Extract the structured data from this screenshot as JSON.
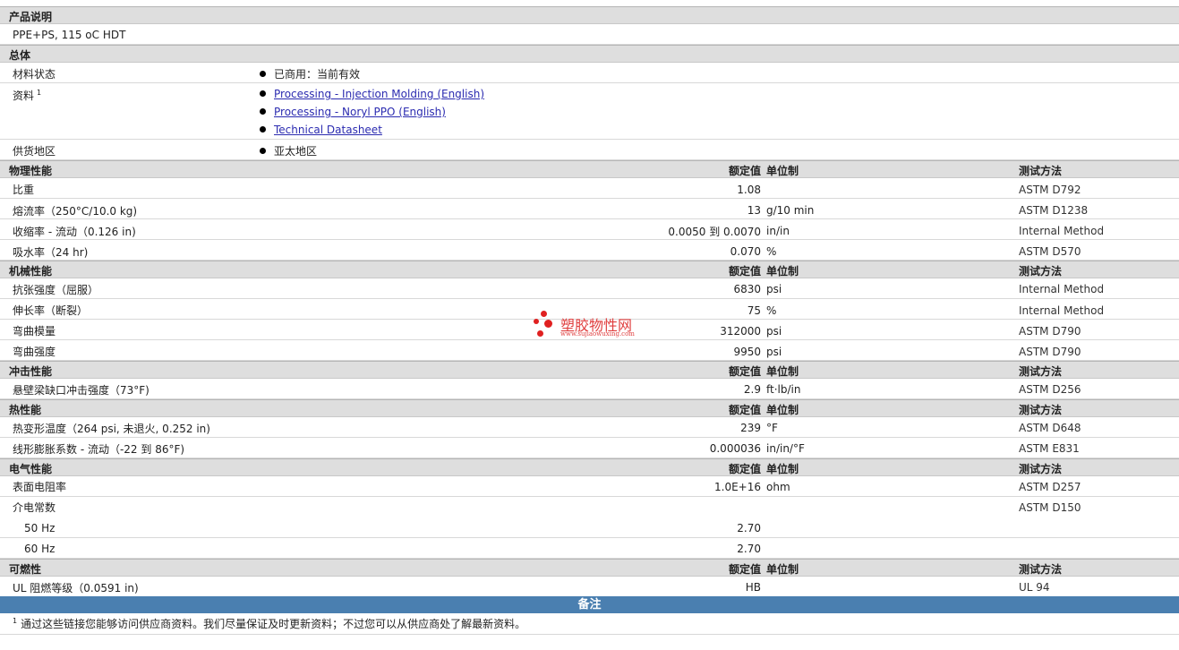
{
  "desc": {
    "title": "产品说明",
    "text": "PPE+PS, 115 oC HDT"
  },
  "general": {
    "title": "总体",
    "material_status_label": "材料状态",
    "material_status_value": "已商用：当前有效",
    "docs_label": "资料",
    "docs_sup": "1",
    "docs": [
      "Processing - Injection Molding (English)",
      "Processing - Noryl PPO (English)",
      "Technical Datasheet"
    ],
    "region_label": "供货地区",
    "region_value": "亚太地区"
  },
  "headers": {
    "value": "额定值",
    "unit": "单位制",
    "method": "测试方法"
  },
  "physical": {
    "title": "物理性能",
    "rows": [
      {
        "label": "比重",
        "value": "1.08",
        "unit": "",
        "method": "ASTM D792"
      },
      {
        "label": "熔流率（250°C/10.0 kg)",
        "value": "13",
        "unit": "g/10 min",
        "method": "ASTM D1238"
      },
      {
        "label": "收缩率 - 流动（0.126 in)",
        "value": "0.0050 到  0.0070",
        "unit": "in/in",
        "method": "Internal Method"
      },
      {
        "label": "吸水率（24 hr)",
        "value": "0.070",
        "unit": "%",
        "method": "ASTM D570"
      }
    ]
  },
  "mechanical": {
    "title": "机械性能",
    "rows": [
      {
        "label": "抗张强度（屈服）",
        "value": "6830",
        "unit": "psi",
        "method": "Internal Method"
      },
      {
        "label": "伸长率（断裂）",
        "value": "75",
        "unit": "%",
        "method": "Internal Method"
      },
      {
        "label": "弯曲模量",
        "value": "312000",
        "unit": "psi",
        "method": "ASTM D790"
      },
      {
        "label": "弯曲强度",
        "value": "9950",
        "unit": "psi",
        "method": "ASTM D790"
      }
    ]
  },
  "impact": {
    "title": "冲击性能",
    "rows": [
      {
        "label": "悬壁梁缺口冲击强度（73°F)",
        "value": "2.9",
        "unit": "ft·lb/in",
        "method": "ASTM D256"
      }
    ]
  },
  "thermal": {
    "title": "热性能",
    "rows": [
      {
        "label": "热变形温度（264 psi, 未退火, 0.252 in)",
        "value": "239",
        "unit": "°F",
        "method": "ASTM D648"
      },
      {
        "label": "线形膨胀系数 - 流动（-22 到  86°F)",
        "value": "0.000036",
        "unit": "in/in/°F",
        "method": "ASTM E831"
      }
    ]
  },
  "electrical": {
    "title": "电气性能",
    "rows": [
      {
        "label": "表面电阻率",
        "value": "1.0E+16",
        "unit": "ohm",
        "method": "ASTM D257"
      },
      {
        "label": "介电常数",
        "value": "",
        "unit": "",
        "method": "ASTM D150"
      },
      {
        "label": "50 Hz",
        "value": "2.70",
        "unit": "",
        "method": ""
      },
      {
        "label": "60 Hz",
        "value": "2.70",
        "unit": "",
        "method": ""
      }
    ]
  },
  "flammability": {
    "title": "可燃性",
    "rows": [
      {
        "label": "UL 阻燃等级（0.0591 in)",
        "value": "HB",
        "unit": "",
        "method": "UL 94"
      }
    ]
  },
  "notes": {
    "title": "备注",
    "sup": "1",
    "text": "通过这些链接您能够访问供应商资料。我们尽量保证及时更新资料；不过您可以从供应商处了解最新资料。"
  },
  "watermark": {
    "name": "塑胶物性网",
    "url": "www.sujiaowuxing.com"
  }
}
